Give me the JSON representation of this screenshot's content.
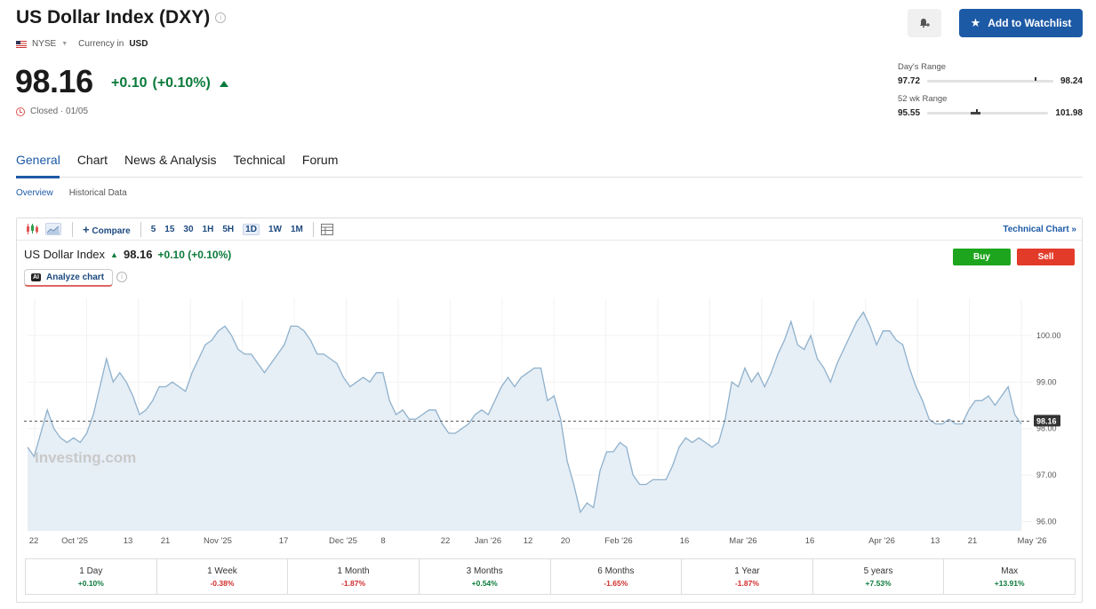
{
  "header": {
    "title": "US Dollar Index (DXY)",
    "exchange": "NYSE",
    "currency_label": "Currency in",
    "currency": "USD",
    "price": "98.16",
    "change_abs": "+0.10",
    "change_pct": "(+0.10%)",
    "status": "Closed · 01/05",
    "watchlist_label": "Add to Watchlist"
  },
  "ranges": {
    "day": {
      "label": "Day's Range",
      "low": "97.72",
      "high": "98.24",
      "position": 0.85
    },
    "week52": {
      "label": "52 wk Range",
      "low": "95.55",
      "high": "101.98",
      "position": 0.4
    }
  },
  "tabs": [
    "General",
    "Chart",
    "News & Analysis",
    "Technical",
    "Forum"
  ],
  "subtabs": [
    "Overview",
    "Historical Data"
  ],
  "toolbar": {
    "compare": "Compare",
    "intervals": [
      "5",
      "15",
      "30",
      "1H",
      "5H",
      "1D",
      "1W",
      "1M"
    ],
    "active_interval": "1D",
    "technical_chart": "Technical Chart »"
  },
  "chart_header": {
    "name": "US Dollar Index",
    "price": "98.16",
    "change": "+0.10 (+0.10%)",
    "analyze": "Analyze chart",
    "ai_badge": "AI",
    "buy": "Buy",
    "sell": "Sell"
  },
  "chart_data": {
    "type": "area",
    "watermark": "Investing.com",
    "last_value": "98.16",
    "ylim": [
      95.8,
      100.8
    ],
    "yticks": [
      "100.00",
      "99.00",
      "98.00",
      "97.00",
      "96.00"
    ],
    "ytick_values": [
      100,
      99,
      98,
      97,
      96
    ],
    "xticks": [
      "22",
      "Oct '25",
      "13",
      "21",
      "Nov '25",
      "17",
      "Dec '25",
      "8",
      "22",
      "Jan '26",
      "12",
      "20",
      "Feb '26",
      "16",
      "Mar '26",
      "16",
      "Apr '26",
      "13",
      "21",
      "May '26"
    ],
    "x_start": "2025-09-22",
    "x_end": "2026-05-05",
    "values": [
      97.6,
      97.4,
      97.9,
      98.4,
      98.0,
      97.8,
      97.7,
      97.8,
      97.7,
      97.9,
      98.3,
      98.9,
      99.5,
      99.0,
      99.2,
      99.0,
      98.7,
      98.3,
      98.4,
      98.6,
      98.9,
      98.9,
      99.0,
      98.9,
      98.8,
      99.2,
      99.5,
      99.8,
      99.9,
      100.1,
      100.2,
      100.0,
      99.7,
      99.6,
      99.6,
      99.4,
      99.2,
      99.4,
      99.6,
      99.8,
      100.2,
      100.2,
      100.1,
      99.9,
      99.6,
      99.6,
      99.5,
      99.4,
      99.1,
      98.9,
      99.0,
      99.1,
      99.0,
      99.2,
      99.2,
      98.6,
      98.3,
      98.4,
      98.2,
      98.2,
      98.3,
      98.4,
      98.4,
      98.1,
      97.9,
      97.9,
      98.0,
      98.1,
      98.3,
      98.4,
      98.3,
      98.6,
      98.9,
      99.1,
      98.9,
      99.1,
      99.2,
      99.3,
      99.3,
      98.6,
      98.7,
      98.2,
      97.3,
      96.8,
      96.2,
      96.4,
      96.3,
      97.1,
      97.5,
      97.5,
      97.7,
      97.6,
      97.0,
      96.8,
      96.8,
      96.9,
      96.9,
      96.9,
      97.2,
      97.6,
      97.8,
      97.7,
      97.8,
      97.7,
      97.6,
      97.7,
      98.2,
      99.0,
      98.9,
      99.3,
      99.0,
      99.2,
      98.9,
      99.2,
      99.6,
      99.9,
      100.3,
      99.8,
      99.7,
      100.0,
      99.5,
      99.3,
      99.0,
      99.4,
      99.7,
      100.0,
      100.3,
      100.5,
      100.2,
      99.8,
      100.1,
      100.1,
      99.9,
      99.8,
      99.3,
      98.9,
      98.6,
      98.2,
      98.1,
      98.1,
      98.2,
      98.1,
      98.1,
      98.4,
      98.6,
      98.6,
      98.7,
      98.5,
      98.7,
      98.9,
      98.3,
      98.1
    ]
  },
  "performance": [
    {
      "label": "1 Day",
      "value": "+0.10%",
      "dir": "pos"
    },
    {
      "label": "1 Week",
      "value": "-0.38%",
      "dir": "neg"
    },
    {
      "label": "1 Month",
      "value": "-1.87%",
      "dir": "neg"
    },
    {
      "label": "3 Months",
      "value": "+0.54%",
      "dir": "pos"
    },
    {
      "label": "6 Months",
      "value": "-1.65%",
      "dir": "neg"
    },
    {
      "label": "1 Year",
      "value": "-1.87%",
      "dir": "neg"
    },
    {
      "label": "5 years",
      "value": "+7.53%",
      "dir": "pos"
    },
    {
      "label": "Max",
      "value": "+13.91%",
      "dir": "pos"
    }
  ],
  "colors": {
    "accent": "#1d5aa6",
    "positive": "#0a7a3a",
    "negative": "#d12c2c",
    "area_fill": "#e6eef6",
    "line": "#8fb1cc"
  }
}
